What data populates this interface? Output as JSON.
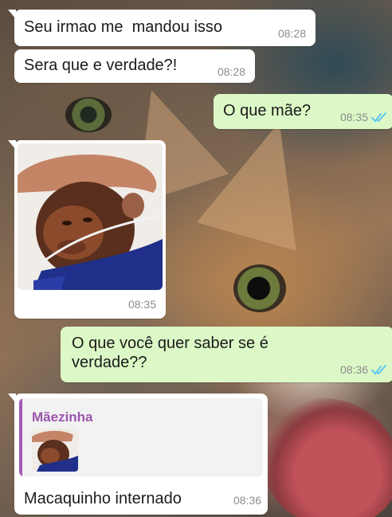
{
  "colors": {
    "incoming_bubble": "#ffffff",
    "outgoing_bubble": "#dcf8c6",
    "timestamp": "#8c8c8c",
    "read_ticks": "#4fc3f7",
    "reply_author": "#9a55ae"
  },
  "messages": [
    {
      "direction": "incoming",
      "text": "Seu irmao me  mandou isso",
      "time": "08:28"
    },
    {
      "direction": "incoming",
      "text": "Sera que e verdade?!",
      "time": "08:28"
    },
    {
      "direction": "outgoing",
      "text": "O que mãe?",
      "time": "08:35",
      "status_icon": "double-check-read-icon"
    },
    {
      "direction": "incoming",
      "type": "image",
      "image_subject": "baby monkey in hospital with oxygen tube",
      "time": "08:35"
    },
    {
      "direction": "outgoing",
      "text": "O que você quer saber se é verdade??",
      "time": "08:36",
      "status_icon": "double-check-read-icon"
    },
    {
      "direction": "incoming",
      "reply_to": {
        "author": "Mãezinha",
        "thumbnail": "baby-monkey-photo"
      },
      "text": "Macaquinho internado",
      "time": "08:36"
    }
  ]
}
